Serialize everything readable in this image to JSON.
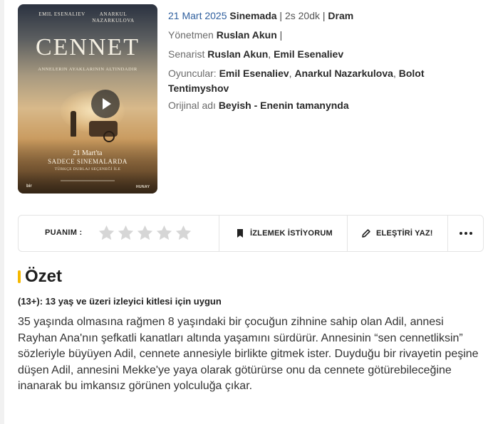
{
  "poster": {
    "actor_1": "EMIL ESENALIEV",
    "actor_2": "ANARKUL NAZARKULOVA",
    "title": "CENNET",
    "subtitle": "ANNELERIN AYAKLARININ ALTINDADIR",
    "release_line": "21 Mart'ta",
    "cinema_line": "SADECE SINEMALARDA",
    "dub_line": "TÜRKÇE DUBLAJ SEÇENEĞİ İLE",
    "brand_right": "HUNAY"
  },
  "info": {
    "release_date": "21 Mart 2025",
    "release_status": "Sinemada",
    "separator": "|",
    "duration": "2s 20dk",
    "genre": "Dram",
    "director_label": "Yönetmen",
    "director": "Ruslan Akun",
    "writer_label": "Senarist",
    "writer_1": "Ruslan Akun",
    "writer_2": "Emil Esenaliev",
    "cast_label": "Oyuncular:",
    "cast_1": "Emil Esenaliev",
    "cast_2": "Anarkul Nazarkulova",
    "cast_3": "Bolot Tentimyshov",
    "original_title_label": "Orijinal adı",
    "original_title": "Beyish - Enenin tamanynda"
  },
  "actions": {
    "rating_label": "PUANIM :",
    "stars": 5,
    "rating_value": 0,
    "watchlist_label": "İZLEMEK İSTİYORUM",
    "review_label": "ELEŞTİRİ YAZ!",
    "more_icon": "ellipsis-icon"
  },
  "summary_section": {
    "title": "Özet",
    "age_rating": "(13+): 13 yaş ve üzeri izleyici kitlesi için uygun",
    "text": "35 yaşında olmasına rağmen 8 yaşındaki bir çocuğun zihnine sahip olan Adil, annesi Rayhan Ana'nın şefkatli kanatları altında yaşamını sürdürür. Annesinin “sen cennetliksin” sözleriyle büyüyen Adil, cennete annesiyle birlikte gitmek ister. Duyduğu bir rivayetin peşine düşen Adil, annesini Mekke'ye yaya olarak götürürse onu da cennete götürebileceğine inanarak bu imkansız görünen yolculuğa çıkar."
  },
  "colors": {
    "accent_yellow": "#f5b800",
    "link_blue": "#2f5f9e",
    "star_empty": "#d6d6d6"
  }
}
